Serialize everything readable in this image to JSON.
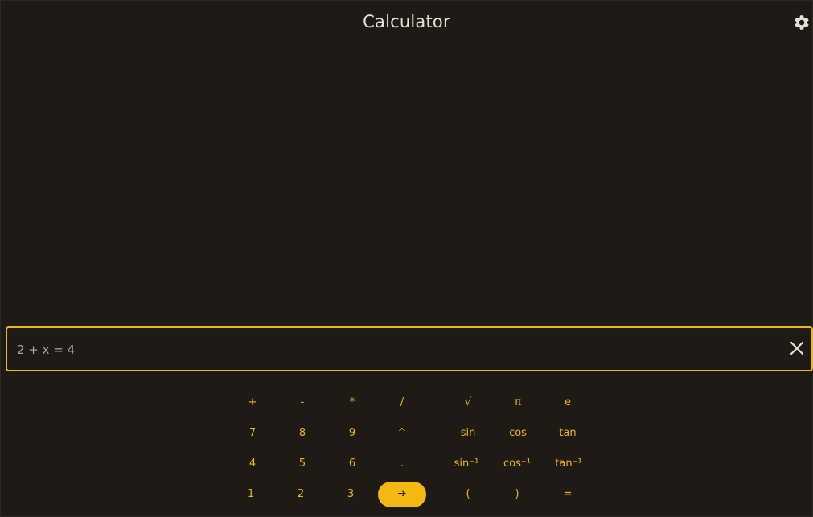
{
  "app": {
    "title": "Calculator",
    "settings_icon": "gear-icon"
  },
  "input": {
    "value": "2 + x = 4",
    "clear_icon": "close-icon"
  },
  "keypad": {
    "row1": [
      "+",
      "-",
      "*",
      "/",
      "√",
      "π",
      "e"
    ],
    "row2": [
      "7",
      "8",
      "9",
      "^",
      "sin",
      "cos",
      "tan"
    ],
    "row3": [
      "4",
      "5",
      "6",
      ".",
      "sin⁻¹",
      "cos⁻¹",
      "tan⁻¹"
    ],
    "row4": [
      "1",
      "2",
      "3",
      "➔",
      "(",
      ")",
      "="
    ]
  },
  "colors": {
    "background": "#1e1b17",
    "accent": "#f2b616",
    "title_text": "#e6e1d8",
    "input_text": "#a9a59d"
  }
}
